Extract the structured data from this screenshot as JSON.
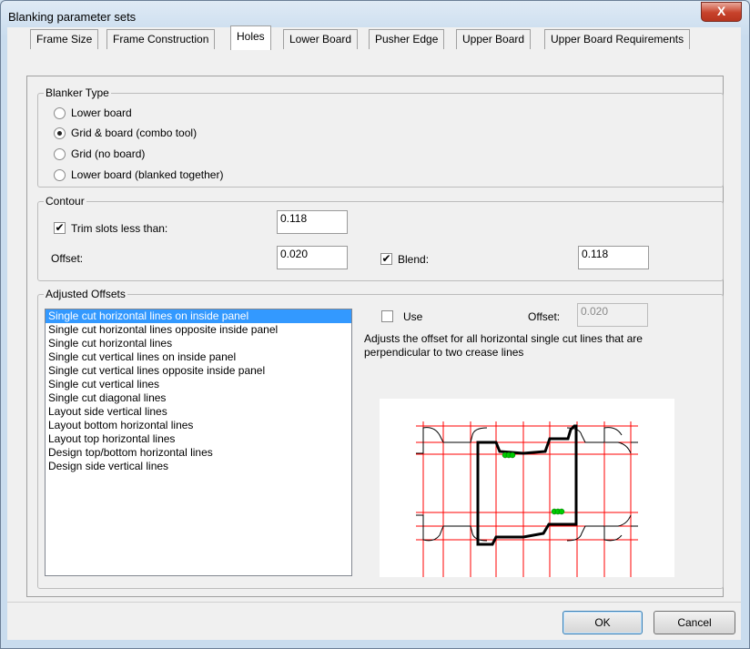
{
  "window": {
    "title": "Blanking parameter sets",
    "close_label": "X"
  },
  "tabs": [
    {
      "label": "Frame Size"
    },
    {
      "label": "Frame Construction"
    },
    {
      "label": "Holes"
    },
    {
      "label": "Lower Board"
    },
    {
      "label": "Pusher Edge"
    },
    {
      "label": "Upper Board"
    },
    {
      "label": "Upper Board Requirements"
    }
  ],
  "active_tab": "Holes",
  "blanker_type": {
    "label": "Blanker Type",
    "options": [
      {
        "label": "Lower board",
        "checked": false
      },
      {
        "label": "Grid & board (combo tool)",
        "checked": true
      },
      {
        "label": "Grid (no board)",
        "checked": false
      },
      {
        "label": "Lower board (blanked together)",
        "checked": false
      }
    ]
  },
  "contour": {
    "label": "Contour",
    "trim_label": "Trim slots less than:",
    "trim_checked": true,
    "trim_value": "0.118",
    "offset_label": "Offset:",
    "offset_value": "0.020",
    "blend_label": "Blend:",
    "blend_checked": true,
    "blend_value": "0.118"
  },
  "adjusted_offsets": {
    "label": "Adjusted Offsets",
    "items": [
      "Single cut horizontal lines on inside panel",
      "Single cut horizontal lines opposite inside panel",
      "Single cut horizontal lines",
      "Single cut vertical lines on inside panel",
      "Single cut vertical lines opposite inside panel",
      "Single cut vertical lines",
      "Single cut diagonal lines",
      "Layout side vertical lines",
      "Layout bottom horizontal lines",
      "Layout top horizontal lines",
      "Design top/bottom horizontal lines",
      "Design side vertical lines"
    ],
    "selected_index": 0,
    "use_label": "Use",
    "use_checked": false,
    "offset_label": "Offset:",
    "offset_value": "0.020",
    "description": "Adjusts the offset for all horizontal single cut lines that are perpendicular to two crease lines"
  },
  "buttons": {
    "ok": "OK",
    "cancel": "Cancel"
  },
  "colors": {
    "selection": "#3399ff",
    "grid_lines": "#ff0000",
    "markers": "#00cc00"
  }
}
